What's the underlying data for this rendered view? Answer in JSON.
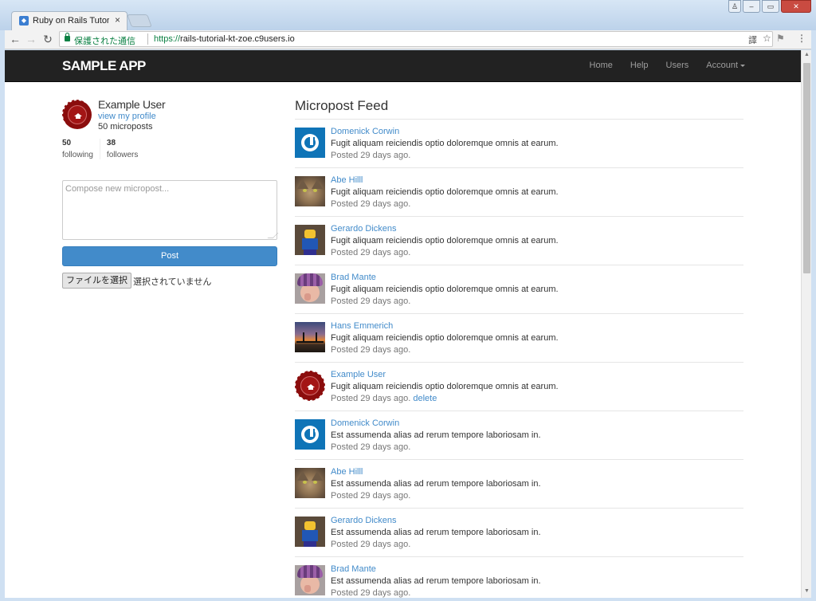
{
  "browser": {
    "tab_title": "Ruby on Rails Tutorial",
    "tab_close": "×",
    "secure_text": "保護された通信",
    "url_scheme": "https://",
    "url_rest": "rails-tutorial-kt-zoe.c9users.io"
  },
  "navbar": {
    "logo": "SAMPLE APP",
    "links": [
      "Home",
      "Help",
      "Users",
      "Account"
    ]
  },
  "sidebar": {
    "name": "Example User",
    "profile_link": "view my profile",
    "micropost_count": "50 microposts",
    "following_count": "50",
    "following_label": "following",
    "followers_count": "38",
    "followers_label": "followers",
    "compose_placeholder": "Compose new micropost...",
    "post_button": "Post",
    "file_button": "ファイルを選択",
    "file_status": "選択されていません"
  },
  "feed": {
    "title": "Micropost Feed",
    "items": [
      {
        "user": "Domenick Corwin",
        "content": "Fugit aliquam reiciendis optio doloremque omnis at earum.",
        "timestamp": "Posted 29 days ago.",
        "avatar": "power-icon"
      },
      {
        "user": "Abe Hilll",
        "content": "Fugit aliquam reiciendis optio doloremque omnis at earum.",
        "timestamp": "Posted 29 days ago.",
        "avatar": "cat-photo"
      },
      {
        "user": "Gerardo Dickens",
        "content": "Fugit aliquam reiciendis optio doloremque omnis at earum.",
        "timestamp": "Posted 29 days ago.",
        "avatar": "lego-photo"
      },
      {
        "user": "Brad Mante",
        "content": "Fugit aliquam reiciendis optio doloremque omnis at earum.",
        "timestamp": "Posted 29 days ago.",
        "avatar": "baby-photo"
      },
      {
        "user": "Hans Emmerich",
        "content": "Fugit aliquam reiciendis optio doloremque omnis at earum.",
        "timestamp": "Posted 29 days ago.",
        "avatar": "sunset-photo"
      },
      {
        "user": "Example User",
        "content": "Fugit aliquam reiciendis optio doloremque omnis at earum.",
        "timestamp": "Posted 29 days ago.",
        "delete": "delete",
        "avatar": "rails-seal"
      },
      {
        "user": "Domenick Corwin",
        "content": "Est assumenda alias ad rerum tempore laboriosam in.",
        "timestamp": "Posted 29 days ago.",
        "avatar": "power-icon"
      },
      {
        "user": "Abe Hilll",
        "content": "Est assumenda alias ad rerum tempore laboriosam in.",
        "timestamp": "Posted 29 days ago.",
        "avatar": "cat-photo"
      },
      {
        "user": "Gerardo Dickens",
        "content": "Est assumenda alias ad rerum tempore laboriosam in.",
        "timestamp": "Posted 29 days ago.",
        "avatar": "lego-photo"
      },
      {
        "user": "Brad Mante",
        "content": "Est assumenda alias ad rerum tempore laboriosam in.",
        "timestamp": "Posted 29 days ago.",
        "avatar": "baby-photo"
      }
    ]
  },
  "colors": {
    "navbar_bg": "#222222",
    "link": "#428bca",
    "primary_button": "#428bca",
    "secure_green": "#0b8043"
  }
}
